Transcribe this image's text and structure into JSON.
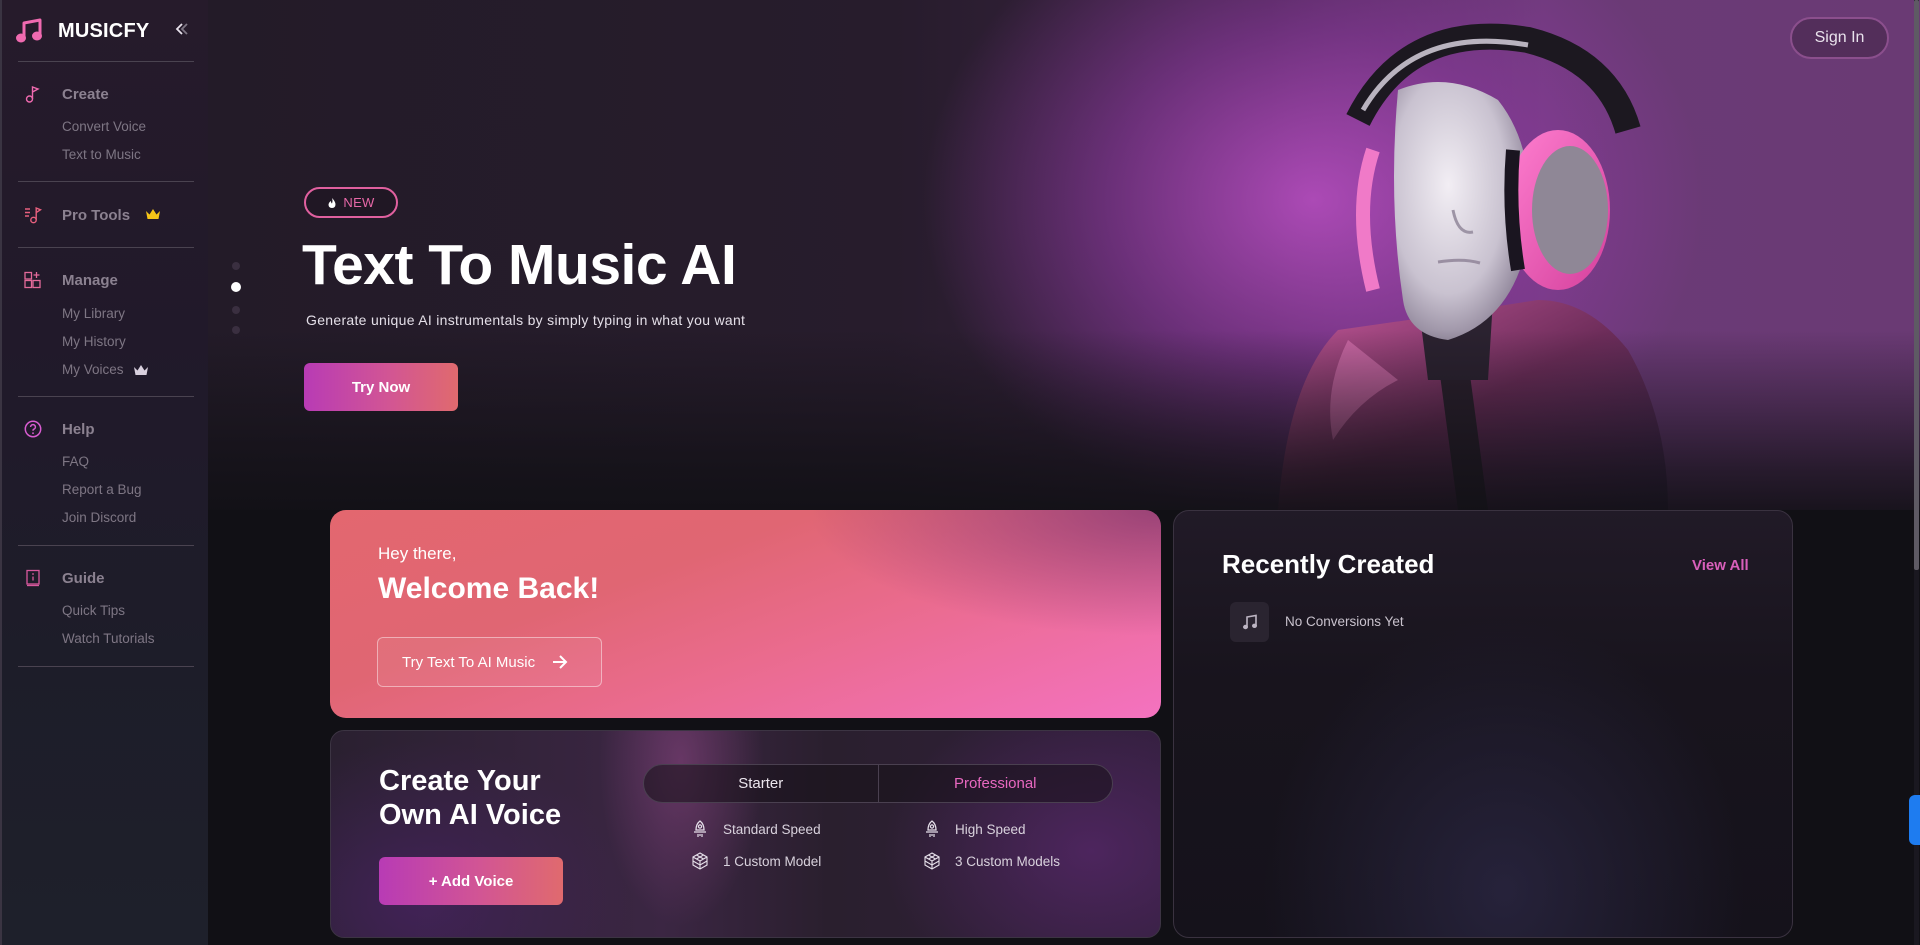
{
  "app": {
    "brand": "MUSICFY",
    "brand_color": "#f06ab0",
    "accent_color": "#d95fbb"
  },
  "sidebar": {
    "collapse_icon": "chevrons-left-icon",
    "sections": [
      {
        "title": "Create",
        "icon": "music-note-icon",
        "items": [
          {
            "label": "Convert Voice"
          },
          {
            "label": "Text to Music"
          }
        ]
      },
      {
        "title": "Pro Tools",
        "icon": "playlist-music-icon",
        "badge": "crown-icon",
        "badge_color": "#f5c518",
        "items": []
      },
      {
        "title": "Manage",
        "icon": "grid-add-icon",
        "items": [
          {
            "label": "My Library"
          },
          {
            "label": "My History"
          },
          {
            "label": "My Voices",
            "badge": "crown-icon",
            "badge_color": "#d8d0de"
          }
        ]
      },
      {
        "title": "Help",
        "icon": "question-circle-icon",
        "items": [
          {
            "label": "FAQ"
          },
          {
            "label": "Report a Bug"
          },
          {
            "label": "Join Discord"
          }
        ]
      },
      {
        "title": "Guide",
        "icon": "info-book-icon",
        "items": [
          {
            "label": "Quick Tips"
          },
          {
            "label": "Watch Tutorials"
          }
        ]
      }
    ]
  },
  "header": {
    "sign_in": "Sign In"
  },
  "hero": {
    "badge": "NEW",
    "badge_icon": "flame-icon",
    "title": "Text To Music AI",
    "subtitle": "Generate unique AI instrumentals by simply typing in what you want",
    "cta": "Try Now",
    "slides_total": 4,
    "active_slide": 2
  },
  "welcome_card": {
    "greeting": "Hey there,",
    "title": "Welcome Back!",
    "cta": "Try Text To AI Music",
    "cta_icon": "arrow-right-icon"
  },
  "voice_card": {
    "title_line1": "Create Your",
    "title_line2": "Own AI Voice",
    "cta": "+ Add Voice",
    "plans": [
      {
        "name": "Starter",
        "features": [
          {
            "icon": "rocket-icon",
            "label": "Standard Speed"
          },
          {
            "icon": "cube-icon",
            "label": "1 Custom Model"
          }
        ]
      },
      {
        "name": "Professional",
        "features": [
          {
            "icon": "rocket-icon",
            "label": "High Speed"
          },
          {
            "icon": "cube-icon",
            "label": "3 Custom Models"
          }
        ]
      }
    ]
  },
  "recent": {
    "title": "Recently Created",
    "view_all": "View All",
    "empty_text": "No Conversions Yet"
  }
}
